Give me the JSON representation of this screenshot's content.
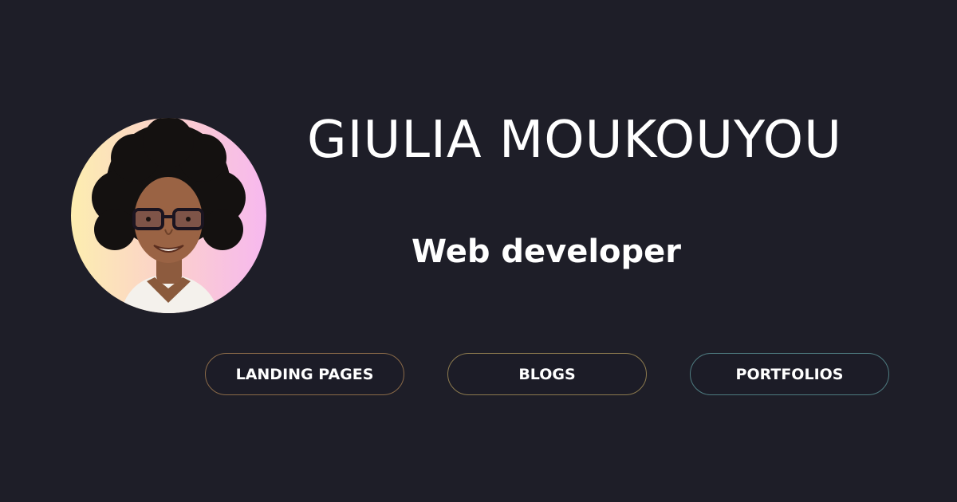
{
  "profile": {
    "name": "GIULIA MOUKOUYOU",
    "role": "Web developer",
    "avatar_icon": "profile-photo",
    "avatar_gradient": [
      "#fdeeb0",
      "#f7b8ef"
    ]
  },
  "tags": [
    {
      "label": "LANDING PAGES",
      "border_color": "#8a6a48"
    },
    {
      "label": "BLOGS",
      "border_color": "#8c7a4e"
    },
    {
      "label": "PORTFOLIOS",
      "border_color": "#4e7b80"
    }
  ],
  "colors": {
    "background": "#1e1e28",
    "text": "#ffffff"
  }
}
